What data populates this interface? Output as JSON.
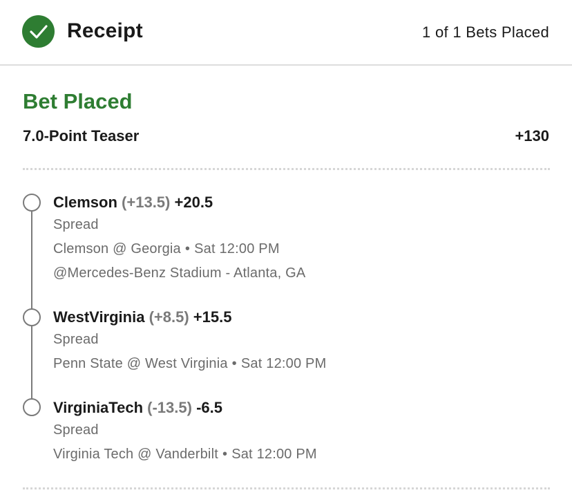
{
  "header": {
    "title": "Receipt",
    "count_text": "1 of 1 Bets Placed",
    "icon": "check-circle-icon",
    "icon_color": "#2e7d32"
  },
  "bet": {
    "status": "Bet Placed",
    "status_color": "#2e7d32",
    "type": "7.0-Point Teaser",
    "odds": "+130"
  },
  "legs": [
    {
      "team": "Clemson",
      "original_line": "(+13.5)",
      "teased_line": "+20.5",
      "market": "Spread",
      "matchup": "Clemson @ Georgia",
      "time": "Sat 12:00 PM",
      "venue": "@Mercedes-Benz Stadium - Atlanta, GA"
    },
    {
      "team": "WestVirginia",
      "original_line": "(+8.5)",
      "teased_line": "+15.5",
      "market": "Spread",
      "matchup": "Penn State @ West Virginia",
      "time": "Sat 12:00 PM"
    },
    {
      "team": "VirginiaTech",
      "original_line": "(-13.5)",
      "teased_line": "-6.5",
      "market": "Spread",
      "matchup": "Virginia Tech @ Vanderbilt",
      "time": "Sat 12:00 PM"
    }
  ],
  "separator": "•"
}
